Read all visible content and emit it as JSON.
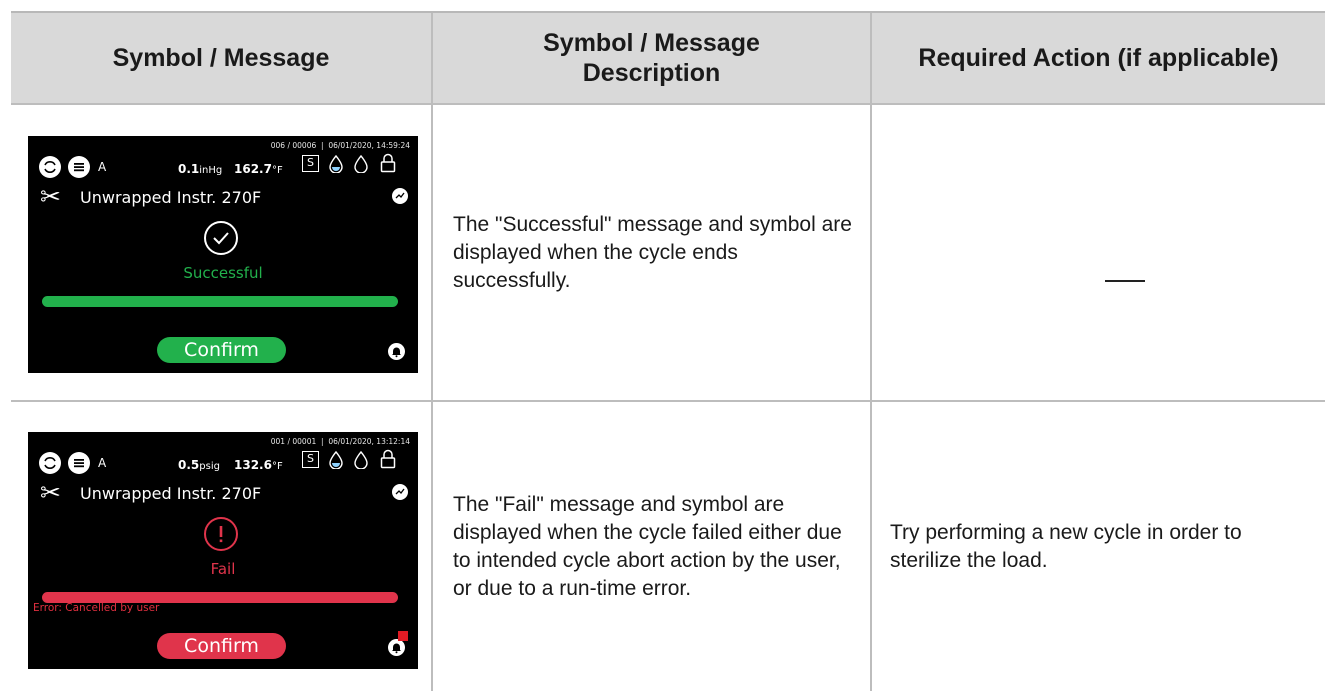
{
  "table": {
    "headers": [
      "Symbol / Message",
      "Symbol / Message Description",
      "Required Action (if applicable)"
    ],
    "rows": [
      {
        "screen": {
          "mode": "A",
          "pressure_value": "0.1",
          "pressure_unit": "inHg",
          "temp_value": "162.7",
          "temp_unit": "°F",
          "counter": "006 / 00006",
          "datetime": "06/01/2020, 14:59:24",
          "sterilizer_box": "S",
          "cycle_name": "Unwrapped Instr. 270F",
          "status_label": "Successful",
          "error_text": "",
          "confirm_label": "Confirm",
          "status_icon": "check-circle-icon",
          "accent_color": "#22b14c"
        },
        "description": "The \"Successful\" message and symbol are displayed when the cycle ends successfully.",
        "action": ""
      },
      {
        "screen": {
          "mode": "A",
          "pressure_value": "0.5",
          "pressure_unit": "psig",
          "temp_value": "132.6",
          "temp_unit": "°F",
          "counter": "001 / 00001",
          "datetime": "06/01/2020, 13:12:14",
          "sterilizer_box": "S",
          "cycle_name": "Unwrapped Instr. 270F",
          "status_label": "Fail",
          "error_text": "Error: Cancelled by user",
          "confirm_label": "Confirm",
          "status_icon": "exclamation-circle-icon",
          "accent_color": "#e0344b"
        },
        "description": "The \"Fail\" message and symbol are displayed when the cycle failed either due to intended cycle abort action by the user, or due to a run-time error.",
        "action": "Try performing a new cycle in order to sterilize the load."
      }
    ]
  }
}
